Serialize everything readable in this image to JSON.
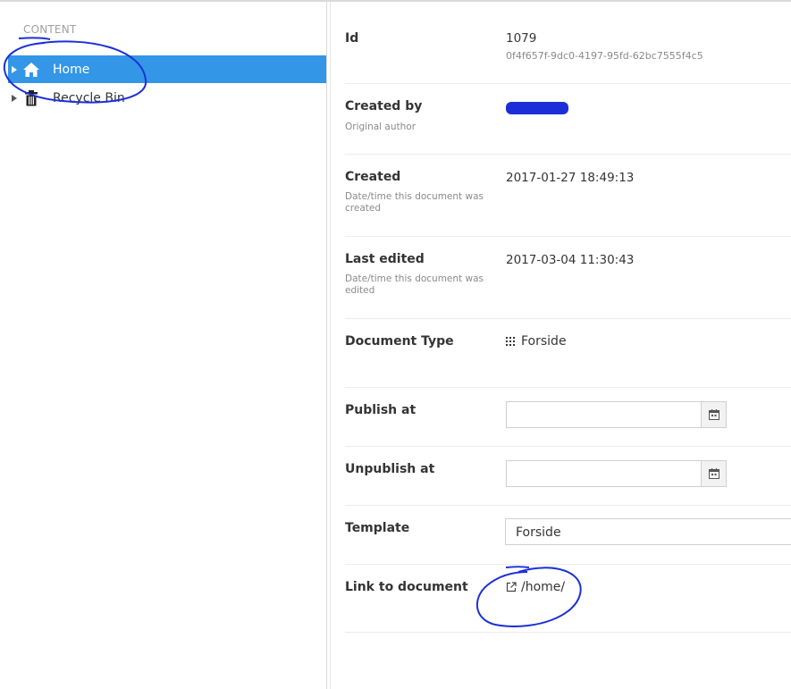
{
  "sidebar": {
    "heading": "CONTENT",
    "items": [
      {
        "label": "Home",
        "icon": "home-icon"
      },
      {
        "label": "Recycle Bin",
        "icon": "trash-icon"
      }
    ]
  },
  "info": {
    "id": {
      "label": "Id",
      "value": "1079",
      "guid": "0f4f657f-9dc0-4197-95fd-62bc7555f4c5"
    },
    "created_by": {
      "label": "Created by",
      "desc": "Original author"
    },
    "created": {
      "label": "Created",
      "desc": "Date/time this document was created",
      "value": "2017-01-27 18:49:13"
    },
    "last_edited": {
      "label": "Last edited",
      "desc": "Date/time this document was edited",
      "value": "2017-03-04 11:30:43"
    },
    "document_type": {
      "label": "Document Type",
      "value": "Forside",
      "icon": "doctype-grid-icon"
    },
    "publish_at": {
      "label": "Publish at",
      "value": ""
    },
    "unpublish_at": {
      "label": "Unpublish at",
      "value": ""
    },
    "template": {
      "label": "Template",
      "value": "Forside"
    },
    "link_to_document": {
      "label": "Link to document",
      "value": "/home/",
      "icon": "external-link-icon"
    }
  },
  "colors": {
    "accent": "#3396e6",
    "annotation_ink": "#1b2fd8"
  }
}
